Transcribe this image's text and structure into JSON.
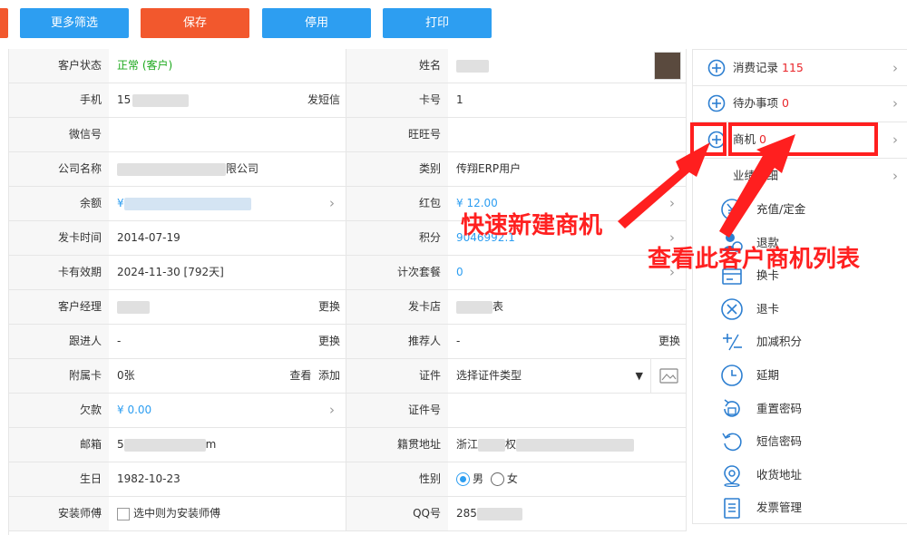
{
  "toolbar": {
    "more_filter": "更多筛选",
    "save": "保存",
    "disable": "停用",
    "print": "打印"
  },
  "form": {
    "status": {
      "label": "客户状态",
      "value": "正常 (客户)"
    },
    "name": {
      "label": "姓名"
    },
    "phone": {
      "label": "手机",
      "value": "15",
      "action": "发短信"
    },
    "card_no": {
      "label": "卡号",
      "value": "1"
    },
    "wechat": {
      "label": "微信号",
      "value": ""
    },
    "wangwang": {
      "label": "旺旺号",
      "value": ""
    },
    "company": {
      "label": "公司名称",
      "value": "限公司"
    },
    "category": {
      "label": "类别",
      "value": "传翔ERP用户"
    },
    "balance": {
      "label": "余额",
      "value": "¥"
    },
    "red_packet": {
      "label": "红包",
      "value": "¥ 12.00"
    },
    "issue_time": {
      "label": "发卡时间",
      "value": "2014-07-19"
    },
    "points": {
      "label": "积分",
      "value": "9046992.1"
    },
    "valid_until": {
      "label": "卡有效期",
      "value": "2024-11-30 [792天]"
    },
    "count_pkg": {
      "label": "计次套餐",
      "value": "0"
    },
    "manager": {
      "label": "客户经理",
      "value": "",
      "action": "更换"
    },
    "issue_store": {
      "label": "发卡店",
      "value": "表"
    },
    "follower": {
      "label": "跟进人",
      "value": "-",
      "action": "更换"
    },
    "referrer": {
      "label": "推荐人",
      "value": "-",
      "action": "更换"
    },
    "sub_card": {
      "label": "附属卡",
      "value": "0张",
      "action_view": "查看",
      "action_add": "添加"
    },
    "certificate": {
      "label": "证件",
      "value": "选择证件类型"
    },
    "debt": {
      "label": "欠款",
      "value": "¥ 0.00"
    },
    "cert_no": {
      "label": "证件号",
      "value": ""
    },
    "email": {
      "label": "邮箱",
      "value_prefix": "5",
      "value_suffix": "m"
    },
    "native_addr": {
      "label": "籍贯地址",
      "value_prefix": "浙江",
      "value_mid": "权"
    },
    "birthday": {
      "label": "生日",
      "value": "1982-10-23"
    },
    "gender": {
      "label": "性别",
      "male": "男",
      "female": "女",
      "selected": "男"
    },
    "installer": {
      "label": "安装师傅",
      "checkbox_text": "选中则为安装师傅"
    },
    "qq": {
      "label": "QQ号",
      "value": "285"
    }
  },
  "sidebar": {
    "consume": {
      "label": "消费记录",
      "count": "115"
    },
    "todo": {
      "label": "待办事项",
      "count": "0"
    },
    "opportunity": {
      "label": "商机",
      "count": "0"
    },
    "performance": {
      "label": "业绩明细"
    },
    "actions": [
      {
        "label": "充值/定金",
        "icon": "yen-circle-icon"
      },
      {
        "label": "退款",
        "icon": "refund-icon"
      },
      {
        "label": "换卡",
        "icon": "card-icon"
      },
      {
        "label": "退卡",
        "icon": "close-circle-icon"
      },
      {
        "label": "加减积分",
        "icon": "plus-minus-icon"
      },
      {
        "label": "延期",
        "icon": "clock-icon"
      },
      {
        "label": "重置密码",
        "icon": "reset-lock-icon"
      },
      {
        "label": "短信密码",
        "icon": "refresh-icon"
      },
      {
        "label": "收货地址",
        "icon": "location-icon"
      },
      {
        "label": "发票管理",
        "icon": "invoice-icon"
      }
    ]
  },
  "annotations": {
    "quick_create": "快速新建商机",
    "view_list": "查看此客户商机列表"
  },
  "colors": {
    "blue": "#2d9ef1",
    "orange": "#f2582d",
    "green": "#1ba81b",
    "red": "#e9262b",
    "annotation_red": "#ff2020"
  }
}
